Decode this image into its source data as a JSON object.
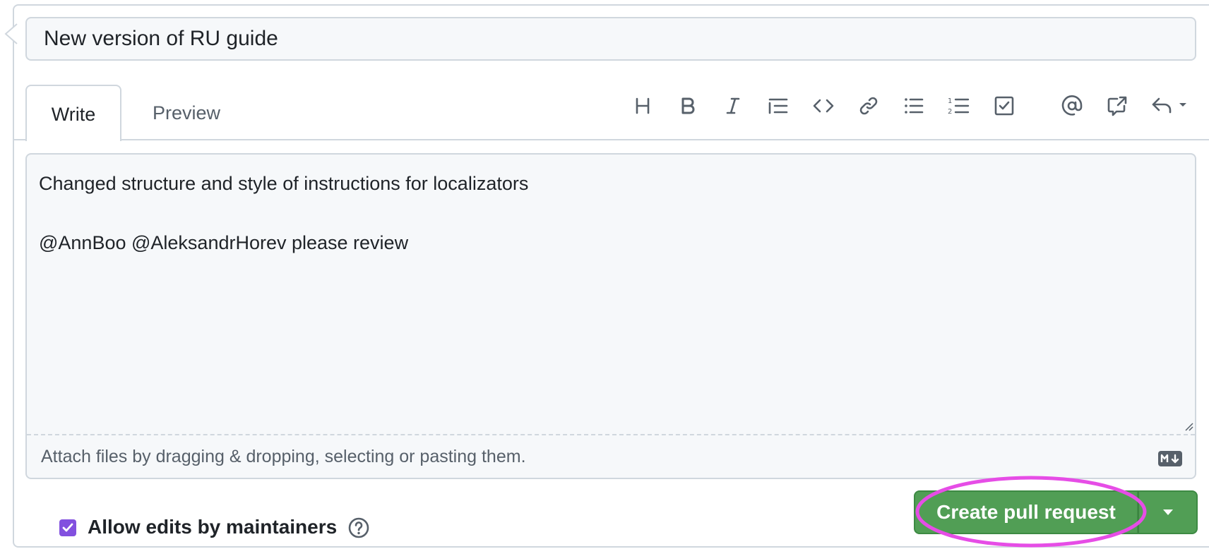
{
  "pull_request": {
    "title_value": "New version of RU guide",
    "tabs": [
      {
        "label": "Write",
        "active": true
      },
      {
        "label": "Preview",
        "active": false
      }
    ],
    "toolbar": {
      "icons": [
        "heading-icon",
        "bold-icon",
        "italic-icon",
        "quote-icon",
        "code-icon",
        "link-icon",
        "unordered-list-icon",
        "ordered-list-icon",
        "task-list-icon",
        "mention-icon",
        "cross-reference-icon",
        "reply-icon"
      ]
    },
    "body_line1": "Changed structure and style of instructions for localizators",
    "body_line2": "@AnnBoo @AleksandrHorev please review",
    "attach_hint": "Attach files by dragging & dropping, selecting or pasting them.",
    "allow_edits_label": "Allow edits by maintainers",
    "allow_edits_checked": true,
    "create_button_label": "Create pull request"
  },
  "colors": {
    "button_green": "#519e55",
    "checkbox_purple": "#8250df",
    "highlight_magenta": "#e64de6",
    "border": "#d0d7de",
    "field_bg": "#f6f8fa"
  }
}
